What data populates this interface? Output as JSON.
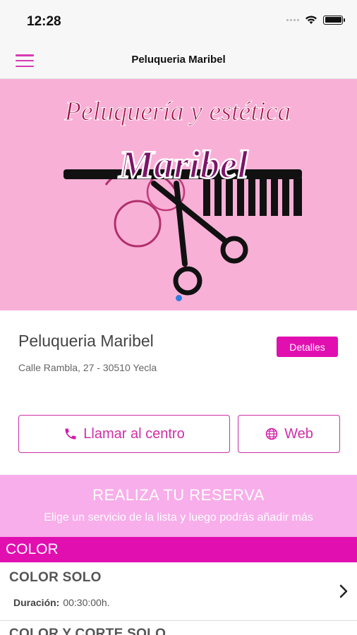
{
  "status_bar": {
    "time": "12:28"
  },
  "nav": {
    "title": "Peluqueria Maribel",
    "menu_icon": "hamburger-icon"
  },
  "hero": {
    "logo_line1": "Peluquería y estética",
    "logo_line2": "Maribel"
  },
  "salon": {
    "name": "Peluqueria Maribel",
    "address": "Calle Rambla, 27 - 30510 Yecla",
    "details_label": "Detalles"
  },
  "actions": {
    "call_label": "Llamar al centro",
    "call_icon": "phone-icon",
    "web_label": "Web",
    "web_icon": "globe-icon"
  },
  "reserve": {
    "title": "REALIZA TU RESERVA",
    "subtitle": "Elige un servicio de la lista y luego podrás añadir más"
  },
  "category": {
    "name": "COLOR"
  },
  "services": [
    {
      "name": "COLOR SOLO",
      "duration_label": "Duración:",
      "duration": "00:30:00h."
    },
    {
      "name": "COLOR Y CORTE SOLO"
    }
  ],
  "colors": {
    "accent": "#e10fb0",
    "hero_bg": "#f9b0d7",
    "banner_bg": "#f8aeea",
    "dot": "#2f7de1"
  }
}
